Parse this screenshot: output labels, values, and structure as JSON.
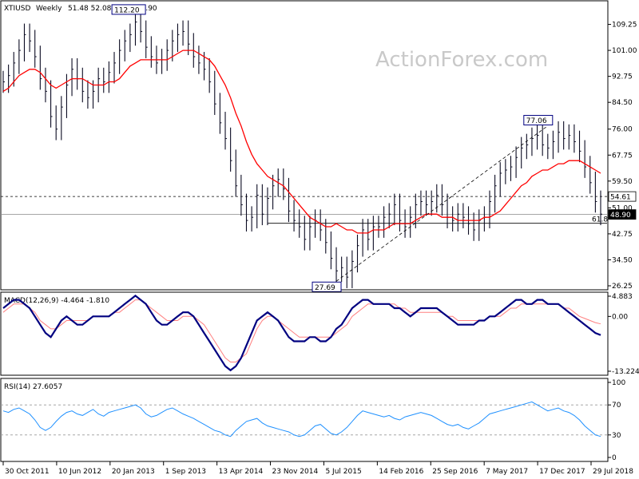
{
  "chart_data": {
    "type": "line",
    "instrument": "XTIUSD",
    "timeframe": "Weekly",
    "header_ohlc": "51.48 52.08 48.09 48.90",
    "watermark": "ActionForex.com",
    "x_labels": [
      "30 Oct 2011",
      "10 Jun 2012",
      "20 Jan 2013",
      "1 Sep 2013",
      "13 Apr 2014",
      "23 Nov 2014",
      "5 Jul 2015",
      "14 Feb 2016",
      "25 Sep 2016",
      "7 May 2017",
      "17 Dec 2017",
      "29 Jul 2018"
    ],
    "price_panel": {
      "ylim": [
        26.25,
        117.5
      ],
      "y_ticks": [
        "109.25",
        "101.00",
        "92.75",
        "84.50",
        "76.00",
        "67.75",
        "59.50",
        "51.00",
        "42.75",
        "34.50",
        "26.25"
      ],
      "close": [
        91,
        93,
        97,
        101,
        106,
        104,
        99,
        92,
        88,
        80,
        76,
        83,
        90,
        95,
        92,
        88,
        86,
        88,
        92,
        91,
        94,
        97,
        101,
        104,
        106,
        110,
        107,
        102,
        99,
        97,
        98,
        101,
        104,
        106,
        107,
        103,
        99,
        97,
        95,
        91,
        84,
        78,
        73,
        66,
        58,
        52,
        47,
        48,
        55,
        49,
        54,
        58,
        60,
        57,
        50,
        47,
        45,
        41,
        45,
        47,
        44,
        40,
        35,
        31,
        32,
        29,
        34,
        39,
        44,
        41,
        45,
        45,
        48,
        49,
        52,
        47,
        45,
        48,
        52,
        53,
        52,
        53,
        55,
        52,
        48,
        47,
        49,
        48,
        46,
        44,
        47,
        48,
        53,
        58,
        62,
        63,
        64,
        67,
        70,
        71,
        73,
        74,
        71,
        70,
        72,
        75,
        73,
        74,
        72,
        69,
        64,
        59,
        53,
        49
      ],
      "ma": [
        88,
        89,
        91,
        93,
        94,
        95,
        95,
        94,
        92,
        90,
        89,
        90,
        91,
        92,
        92,
        92,
        91,
        90,
        90,
        90,
        91,
        91,
        92,
        94,
        96,
        97,
        98,
        98,
        98,
        98,
        98,
        98,
        99,
        100,
        101,
        101,
        101,
        100,
        99,
        98,
        96,
        93,
        90,
        86,
        81,
        77,
        72,
        68,
        65,
        63,
        61,
        60,
        59,
        58,
        56,
        54,
        52,
        50,
        48,
        47,
        46,
        45,
        45,
        46,
        45,
        44,
        44,
        43,
        43,
        43,
        44,
        44,
        44,
        45,
        46,
        46,
        46,
        46,
        47,
        48,
        49,
        49,
        49,
        48,
        48,
        48,
        47,
        47,
        47,
        47,
        47,
        48,
        48,
        49,
        50,
        52,
        54,
        56,
        58,
        59,
        61,
        62,
        63,
        63,
        64,
        65,
        65,
        66,
        66,
        66,
        65,
        64,
        63,
        62
      ],
      "trendline_points": [
        {
          "x": 63,
          "y": 27.69
        },
        {
          "x": 103,
          "y": 77.06
        }
      ],
      "levels": [
        {
          "name": "resistance",
          "value": 54.61,
          "style": "dashed"
        },
        {
          "name": "last",
          "value": 48.9,
          "style": "solid"
        },
        {
          "name": "fib-61.8",
          "value": 46.1,
          "style": "solid",
          "label": "61.8"
        }
      ],
      "annotations": [
        {
          "label": "112.20",
          "index": 26,
          "value": 112.2,
          "where": "above"
        },
        {
          "label": "27.69",
          "index": 63,
          "value": 27.69,
          "where": "below"
        },
        {
          "label": "77.06",
          "index": 103,
          "value": 77.06,
          "where": "above"
        }
      ],
      "price_tags": [
        {
          "label": "54.61",
          "value": 54.61,
          "bg": "#ffffff"
        },
        {
          "label": "48.90",
          "value": 48.9,
          "bg": "#000000"
        }
      ]
    },
    "macd_panel": {
      "title": "MACD(12,26,9) -4.464 -1.810",
      "ylim": [
        -13.224,
        4.883
      ],
      "y_ticks": [
        "4.883",
        "0.00",
        "-13.224"
      ],
      "macd": [
        2,
        3,
        4,
        4,
        3,
        2,
        0,
        -2,
        -4,
        -5,
        -3,
        -1,
        0,
        -1,
        -2,
        -2,
        -1,
        0,
        0,
        0,
        0,
        1,
        2,
        3,
        4,
        5,
        4,
        3,
        1,
        -1,
        -2,
        -2,
        -1,
        0,
        1,
        1,
        0,
        -2,
        -4,
        -6,
        -8,
        -10,
        -12,
        -13,
        -12,
        -10,
        -7,
        -4,
        -1,
        0,
        1,
        0,
        -1,
        -3,
        -5,
        -6,
        -6,
        -6,
        -5,
        -5,
        -6,
        -6,
        -5,
        -3,
        -2,
        0,
        2,
        3,
        4,
        4,
        3,
        3,
        3,
        3,
        2,
        2,
        1,
        0,
        1,
        2,
        2,
        2,
        2,
        1,
        0,
        -1,
        -2,
        -2,
        -2,
        -2,
        -1,
        -1,
        0,
        0,
        1,
        2,
        3,
        4,
        4,
        3,
        3,
        4,
        4,
        3,
        3,
        3,
        2,
        1,
        0,
        -1,
        -2,
        -3,
        -4,
        -4.5
      ],
      "signal": [
        1,
        2,
        3,
        3,
        3,
        2,
        1,
        -1,
        -2,
        -3,
        -3,
        -2,
        -1,
        -1,
        -1,
        -1,
        -1,
        0,
        0,
        0,
        0,
        1,
        1,
        2,
        3,
        4,
        4,
        3,
        2,
        1,
        0,
        -1,
        -1,
        -1,
        0,
        0,
        0,
        -1,
        -2,
        -4,
        -6,
        -8,
        -10,
        -11,
        -11,
        -10,
        -9,
        -6,
        -3,
        -1,
        0,
        0,
        -1,
        -2,
        -3,
        -4,
        -5,
        -5,
        -5,
        -5,
        -5,
        -5,
        -5,
        -4,
        -3,
        -2,
        0,
        1,
        2,
        3,
        3,
        3,
        3,
        3,
        3,
        2,
        2,
        1,
        1,
        1,
        1,
        1,
        1,
        1,
        0,
        0,
        -1,
        -1,
        -1,
        -1,
        -1,
        -1,
        0,
        0,
        0,
        1,
        2,
        2,
        3,
        3,
        3,
        3,
        3,
        3,
        3,
        3,
        2,
        2,
        1,
        0,
        -0.5,
        -1,
        -1.5,
        -1.8
      ]
    },
    "rsi_panel": {
      "title": "RSI(14) 27.6057",
      "ylim": [
        0,
        100
      ],
      "y_ticks": [
        "100",
        "70",
        "30",
        "0"
      ],
      "levels": [
        70,
        30
      ],
      "rsi": [
        62,
        60,
        64,
        66,
        62,
        58,
        50,
        40,
        36,
        40,
        48,
        55,
        60,
        62,
        58,
        56,
        60,
        64,
        58,
        55,
        60,
        62,
        64,
        66,
        68,
        70,
        66,
        58,
        54,
        56,
        60,
        64,
        66,
        62,
        58,
        55,
        52,
        48,
        44,
        40,
        36,
        34,
        30,
        28,
        36,
        42,
        48,
        50,
        52,
        46,
        42,
        40,
        38,
        36,
        34,
        30,
        28,
        30,
        36,
        42,
        44,
        38,
        32,
        30,
        34,
        40,
        48,
        56,
        62,
        60,
        58,
        56,
        54,
        56,
        52,
        50,
        54,
        56,
        58,
        60,
        58,
        56,
        52,
        48,
        44,
        42,
        44,
        40,
        38,
        42,
        46,
        52,
        58,
        60,
        62,
        64,
        66,
        68,
        70,
        72,
        74,
        70,
        66,
        62,
        64,
        66,
        62,
        60,
        56,
        50,
        42,
        36,
        30,
        28
      ]
    },
    "colors": {
      "bars": "#0b0b22",
      "ma": "#ff0000",
      "macd": "#000080",
      "signal": "#ff8080",
      "rsi": "#1e90ff",
      "level_line": "#555555",
      "label_border": "#000080"
    }
  }
}
